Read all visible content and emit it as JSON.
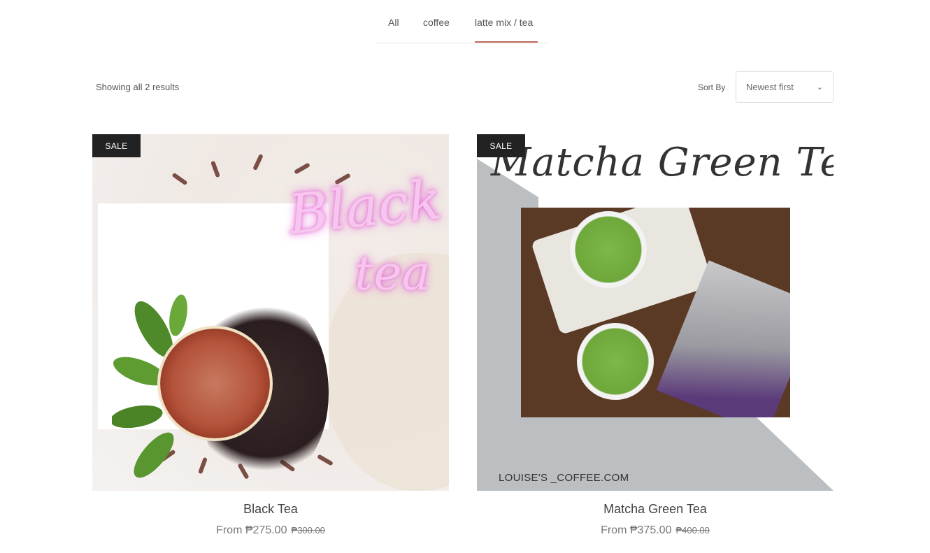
{
  "tabs": [
    {
      "label": "All"
    },
    {
      "label": "coffee"
    },
    {
      "label": "latte mix / tea"
    }
  ],
  "active_tab": "latte mix / tea",
  "results_text": "Showing all 2 results",
  "sort": {
    "label": "Sort By",
    "selected": "Newest first"
  },
  "accent_color": "#c46b5b",
  "products": [
    {
      "badge": "SALE",
      "image_text": [
        "Black",
        "tea"
      ],
      "name": "Black Tea",
      "price": "From ₱275.00",
      "old_price": "₱300.00"
    },
    {
      "badge": "SALE",
      "image_text": [
        "Matcha Green Tea",
        "LOUISE'S _COFFEE.COM"
      ],
      "name": "Matcha Green Tea",
      "price": "From ₱375.00",
      "old_price": "₱400.00"
    }
  ]
}
